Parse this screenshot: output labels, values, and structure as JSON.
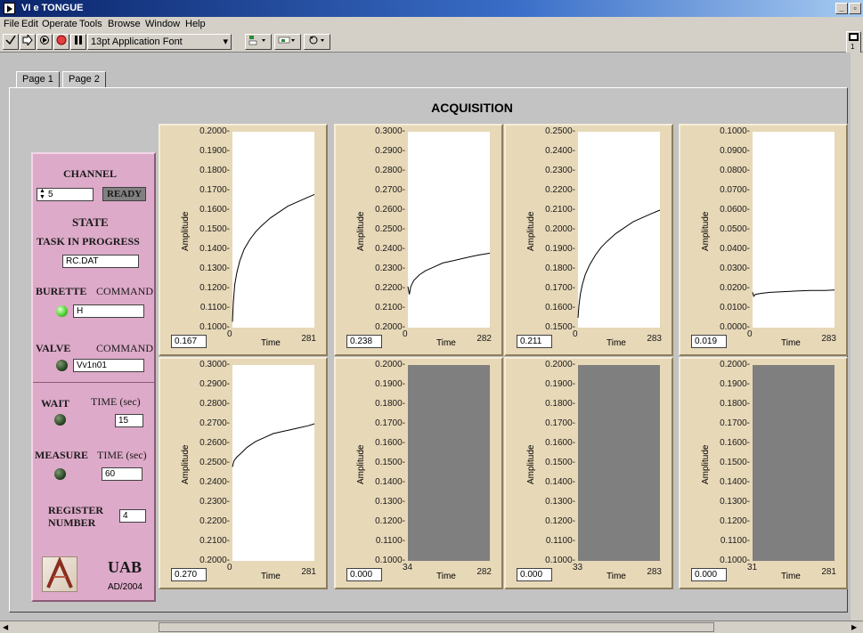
{
  "window": {
    "title": "VI e TONGUE"
  },
  "menu": [
    "File",
    "Edit",
    "Operate",
    "Tools",
    "Browse",
    "Window",
    "Help"
  ],
  "toolbar": {
    "font_label": "13pt Application Font"
  },
  "tabs": [
    {
      "label": "Page 1",
      "active": true
    },
    {
      "label": "Page 2",
      "active": false
    }
  ],
  "page": {
    "title": "ACQUISITION"
  },
  "panel": {
    "channel_label": "CHANNEL",
    "channel_value": "5",
    "ready_label": "READY",
    "state_label": "STATE",
    "task_label": "TASK IN PROGRESS",
    "task_value": "RC.DAT",
    "burette_label": "BURETTE",
    "burette_command_label": "COMMAND",
    "burette_command": "H",
    "valve_label": "VALVE",
    "valve_command_label": "COMMAND",
    "valve_command": "Vv1n01",
    "wait_label": "WAIT",
    "wait_time_label": "TIME (sec)",
    "wait_value": "15",
    "measure_label": "MEASURE",
    "measure_time_label": "TIME (sec)",
    "measure_value": "60",
    "register_label_1": "REGISTER",
    "register_label_2": "NUMBER",
    "register_value": "4",
    "logo_text": "UAB",
    "logo_sub": "AD/2004"
  },
  "colors": {
    "panel": "#ddaac9",
    "chart_frame": "#e7d8b8",
    "led_on": "#55d433"
  },
  "chart_data": [
    {
      "type": "line",
      "ylabel": "Amplitude",
      "xlabel": "Time",
      "ylim": [
        0.1,
        0.2
      ],
      "yticks": [
        "0.2000",
        "0.1900",
        "0.1800",
        "0.1700",
        "0.1600",
        "0.1500",
        "0.1400",
        "0.1300",
        "0.1200",
        "0.1100",
        "0.1000"
      ],
      "xmin_label": "0",
      "xmax_label": "281",
      "xlim": [
        0,
        281
      ],
      "readout": "0.167",
      "empty": false,
      "series": [
        {
          "x": [
            0,
            3,
            8,
            15,
            25,
            40,
            60,
            80,
            100,
            130,
            160,
            190,
            220,
            250,
            281
          ],
          "y": [
            0.103,
            0.113,
            0.122,
            0.128,
            0.134,
            0.14,
            0.145,
            0.149,
            0.152,
            0.156,
            0.159,
            0.162,
            0.164,
            0.166,
            0.168
          ]
        }
      ]
    },
    {
      "type": "line",
      "ylabel": "Amplitude",
      "xlabel": "Time",
      "ylim": [
        0.2,
        0.3
      ],
      "yticks": [
        "0.3000",
        "0.2900",
        "0.2800",
        "0.2700",
        "0.2600",
        "0.2500",
        "0.2400",
        "0.2300",
        "0.2200",
        "0.2100",
        "0.2000"
      ],
      "xmin_label": "0",
      "xmax_label": "282",
      "xlim": [
        0,
        282
      ],
      "readout": "0.238",
      "empty": false,
      "series": [
        {
          "x": [
            0,
            5,
            10,
            20,
            40,
            60,
            90,
            120,
            150,
            180,
            210,
            240,
            282
          ],
          "y": [
            0.221,
            0.217,
            0.221,
            0.224,
            0.227,
            0.229,
            0.231,
            0.233,
            0.234,
            0.235,
            0.236,
            0.237,
            0.238
          ]
        }
      ]
    },
    {
      "type": "line",
      "ylabel": "Amplitude",
      "xlabel": "Time",
      "ylim": [
        0.15,
        0.25
      ],
      "yticks": [
        "0.2500",
        "0.2400",
        "0.2300",
        "0.2200",
        "0.2100",
        "0.2000",
        "0.1900",
        "0.1800",
        "0.1700",
        "0.1600",
        "0.1500"
      ],
      "xmin_label": "0",
      "xmax_label": "283",
      "xlim": [
        0,
        283
      ],
      "readout": "0.211",
      "empty": false,
      "series": [
        {
          "x": [
            0,
            3,
            8,
            15,
            25,
            40,
            60,
            80,
            100,
            130,
            160,
            190,
            220,
            250,
            283
          ],
          "y": [
            0.155,
            0.161,
            0.167,
            0.172,
            0.177,
            0.182,
            0.187,
            0.191,
            0.194,
            0.198,
            0.201,
            0.204,
            0.206,
            0.208,
            0.21
          ]
        }
      ]
    },
    {
      "type": "line",
      "ylabel": "Amplitude",
      "xlabel": "Time",
      "ylim": [
        0.0,
        0.1
      ],
      "yticks": [
        "0.1000",
        "0.0900",
        "0.0800",
        "0.0700",
        "0.0600",
        "0.0500",
        "0.0400",
        "0.0300",
        "0.0200",
        "0.0100",
        "0.0000"
      ],
      "xmin_label": "0",
      "xmax_label": "283",
      "xlim": [
        0,
        283
      ],
      "readout": "0.019",
      "empty": false,
      "series": [
        {
          "x": [
            0,
            4,
            10,
            30,
            60,
            100,
            150,
            200,
            250,
            283
          ],
          "y": [
            0.018,
            0.016,
            0.017,
            0.0175,
            0.018,
            0.0183,
            0.0187,
            0.019,
            0.019,
            0.0192
          ]
        }
      ]
    },
    {
      "type": "line",
      "ylabel": "Amplitude",
      "xlabel": "Time",
      "ylim": [
        0.2,
        0.3
      ],
      "yticks": [
        "0.3000",
        "0.2900",
        "0.2800",
        "0.2700",
        "0.2600",
        "0.2500",
        "0.2400",
        "0.2300",
        "0.2200",
        "0.2100",
        "0.2000"
      ],
      "xmin_label": "0",
      "xmax_label": "281",
      "xlim": [
        0,
        281
      ],
      "readout": "0.270",
      "empty": false,
      "series": [
        {
          "x": [
            0,
            5,
            15,
            30,
            50,
            80,
            110,
            140,
            170,
            200,
            230,
            260,
            281
          ],
          "y": [
            0.248,
            0.251,
            0.253,
            0.255,
            0.258,
            0.261,
            0.263,
            0.265,
            0.266,
            0.267,
            0.268,
            0.269,
            0.27
          ]
        }
      ]
    },
    {
      "type": "line",
      "ylabel": "Amplitude",
      "xlabel": "Time",
      "ylim": [
        0.1,
        0.2
      ],
      "yticks": [
        "0.2000",
        "0.1900",
        "0.1800",
        "0.1700",
        "0.1600",
        "0.1500",
        "0.1400",
        "0.1300",
        "0.1200",
        "0.1100",
        "0.1000"
      ],
      "xmin_label": "34",
      "xmax_label": "282",
      "xlim": [
        34,
        282
      ],
      "readout": "0.000",
      "empty": true,
      "series": []
    },
    {
      "type": "line",
      "ylabel": "Amplitude",
      "xlabel": "Time",
      "ylim": [
        0.1,
        0.2
      ],
      "yticks": [
        "0.2000",
        "0.1900",
        "0.1800",
        "0.1700",
        "0.1600",
        "0.1500",
        "0.1400",
        "0.1300",
        "0.1200",
        "0.1100",
        "0.1000"
      ],
      "xmin_label": "33",
      "xmax_label": "283",
      "xlim": [
        33,
        283
      ],
      "readout": "0.000",
      "empty": true,
      "series": []
    },
    {
      "type": "line",
      "ylabel": "Amplitude",
      "xlabel": "Time",
      "ylim": [
        0.1,
        0.2
      ],
      "yticks": [
        "0.2000",
        "0.1900",
        "0.1800",
        "0.1700",
        "0.1600",
        "0.1500",
        "0.1400",
        "0.1300",
        "0.1200",
        "0.1100",
        "0.1000"
      ],
      "xmin_label": "31",
      "xmax_label": "281",
      "xlim": [
        31,
        281
      ],
      "readout": "0.000",
      "empty": true,
      "series": []
    }
  ]
}
